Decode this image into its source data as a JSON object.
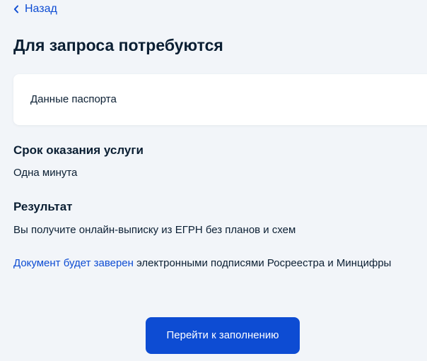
{
  "nav": {
    "back_label": "Назад"
  },
  "page": {
    "title": "Для запроса потребуются"
  },
  "requirements": {
    "items": [
      "Данные паспорта"
    ]
  },
  "duration": {
    "heading": "Срок оказания услуги",
    "value": "Одна минута"
  },
  "result": {
    "heading": "Результат",
    "value": "Вы получите онлайн-выписку из ЕГРН без планов и схем"
  },
  "signature_note": {
    "link_text": "Документ будет заверен",
    "text": " электронными подписями Росреестра и Минцифры"
  },
  "actions": {
    "primary_label": "Перейти к заполнению"
  },
  "colors": {
    "background": "#f2f5f9",
    "accent": "#0d4cd3",
    "text": "#0b1f33",
    "card": "#ffffff"
  },
  "icons": {
    "back": "chevron-left-icon"
  }
}
